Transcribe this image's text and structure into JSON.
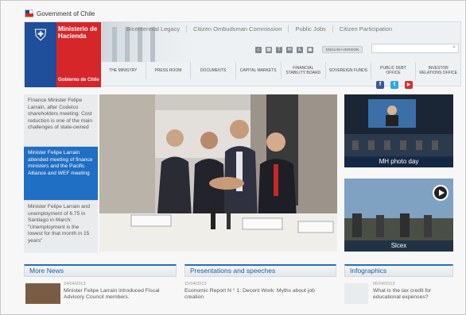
{
  "gov_bar": {
    "label": "Government of Chile"
  },
  "logo": {
    "ministry": "Ministerio de Hacienda",
    "gov": "Gobierno de Chile"
  },
  "top_nav": [
    {
      "label": "Bicentennial Legacy"
    },
    {
      "label": "Citizen Ombudsman Commission"
    },
    {
      "label": "Public Jobs"
    },
    {
      "label": "Citizen Participation"
    }
  ],
  "tools": {
    "english_button": "ENGLISH VERSION"
  },
  "main_nav": [
    {
      "label": "THE MINISTRY"
    },
    {
      "label": "PRESS ROOM"
    },
    {
      "label": "DOCUMENTS"
    },
    {
      "label": "CAPITAL MARKETS"
    },
    {
      "label": "FINANCIAL STABILITY BOARD"
    },
    {
      "label": "SOVEREIGN FUNDS"
    },
    {
      "label": "PUBLIC DEBT OFFICE"
    },
    {
      "label": "INVESTOR RELATIONS OFFICE"
    }
  ],
  "social": {
    "facebook": "f",
    "twitter": "t",
    "youtube": "▶"
  },
  "news_list": [
    {
      "text": "Finance Minister Felipe Larrain, after Codelco shareholders meeting: Cost reduction is one of the main challenges of state-owned"
    },
    {
      "text": "Minister Felipe Larrain attended meeting of finance ministers and the Pacific Alliance and WEF meeting"
    },
    {
      "text": "Minister Felipe Larrain and unemployment of 6.75 in Santiago in March: \"Unemployment is the lowest for that month in 15 years\""
    }
  ],
  "media": {
    "photo_day": "MH photo day",
    "video": "Slcex"
  },
  "sections": {
    "more_news": {
      "title": "More News",
      "date": "24/04/2013",
      "text": "Minister Felipe Larrain introduced Fiscal Advisory Council members."
    },
    "presentations": {
      "title": "Presentations and speeches",
      "date": "15/04/2013",
      "text": "Economic Report N ° 1: Decent Work: Myths about job creation"
    },
    "infographics": {
      "title": "Infographics",
      "date": "05/04/2013",
      "text": "What is the tax credit for educational expenses?"
    }
  }
}
